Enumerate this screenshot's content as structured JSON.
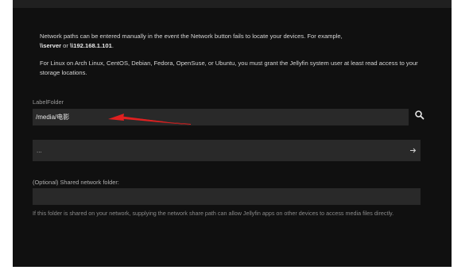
{
  "info": {
    "line1_pre": "Network paths can be entered manually in the event the Network button fails to locate your devices. For example,",
    "example_prefix": "\\\\server",
    "example_or": " or ",
    "example_suffix": "\\\\192.168.1.101",
    "example_end": ".",
    "line2": "For Linux on Arch Linux, CentOS, Debian, Fedora, OpenSuse, or Ubuntu, you must grant the Jellyfin system user at least read access to your storage locations."
  },
  "folder": {
    "label": "LabelFolder",
    "value": "/media/电影"
  },
  "network_select": {
    "value": "..."
  },
  "shared_folder": {
    "label": "(Optional) Shared network folder:",
    "value": "",
    "help": "If this folder is shared on your network, supplying the network share path can allow Jellyfin apps on other devices to access media files directly."
  },
  "colors": {
    "background": "#101010",
    "field": "#292929",
    "annotation_arrow": "#e02020"
  },
  "icons": {
    "search": "search-icon",
    "arrow": "arrow-right-icon"
  }
}
